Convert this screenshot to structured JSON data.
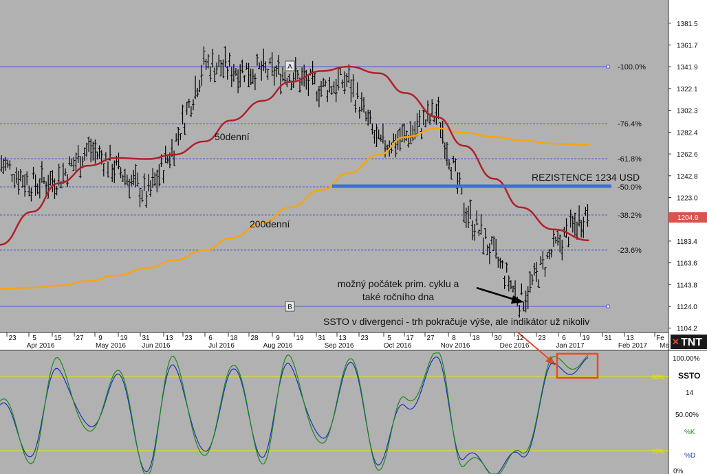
{
  "colors": {
    "background": "#b1b1b1",
    "price_bars": "#000000",
    "ma50": "#b0202a",
    "ma200": "#f6a50e",
    "fib_lines": "#2b3fd8",
    "resistance": "#3f6fd6",
    "stoch_k": "#1a8a1a",
    "stoch_d": "#1f2fb8",
    "stoch_levels": "#e8e800",
    "price_label_bg": "#d9534f",
    "callout_box": "#e8492c"
  },
  "price_axis": {
    "ticks": [
      "1381.5",
      "1361.7",
      "1341.9",
      "1322.1",
      "1302.3",
      "1282.4",
      "1262.6",
      "1242.8",
      "1223.0",
      "1204.9",
      "1183.4",
      "1163.6",
      "1143.8",
      "1124.0",
      "1104.2"
    ],
    "current_price": "1204.9"
  },
  "date_axis": {
    "day_labels": [
      "23",
      "5",
      "15",
      "27",
      "9",
      "19",
      "31",
      "13",
      "23",
      "6",
      "18",
      "28",
      "9",
      "19",
      "31",
      "13",
      "23",
      "5",
      "17",
      "27",
      "8",
      "18",
      "30",
      "12",
      "23",
      "6",
      "19",
      "31",
      "13",
      "Fe"
    ],
    "month_labels": [
      "Apr 2016",
      "May 2016",
      "Jun 2016",
      "Jul 2016",
      "Aug 2016",
      "Sep 2016",
      "Oct 2016",
      "Nov 2016",
      "Dec 2016",
      "Jan 2017",
      "Feb 2017",
      "Ma"
    ]
  },
  "fib_labels": [
    "-100.0%",
    "-76.4%",
    "-61.8%",
    "-50.0%",
    "-38.2%",
    "-23.6%"
  ],
  "point_labels": {
    "a": "A",
    "b": "B"
  },
  "annotations": {
    "ma50": "50denní",
    "ma200": "200denní",
    "resistance": "REZISTENCE 1234 USD",
    "cycle_low_1": "možný počátek prim. cyklu a",
    "cycle_low_2": "také ročního dna",
    "divergence": "SSTO v divergenci - trh pokračuje výše, ale indikátor už nikoliv"
  },
  "oscillator": {
    "name": "SSTO",
    "period": "14",
    "levels": [
      "100.00%",
      "80%",
      "50.00%",
      "20%",
      "0%"
    ],
    "level_80": "80%",
    "level_20": "20%",
    "k_label": "%K",
    "d_label": "%D"
  },
  "logo_text": "TNT",
  "chart_data": [
    {
      "type": "line",
      "title": "",
      "x": [
        "2016-03-15",
        "2016-04-01",
        "2016-04-15",
        "2016-05-01",
        "2016-05-15",
        "2016-06-01",
        "2016-06-15",
        "2016-07-01",
        "2016-07-15",
        "2016-08-01",
        "2016-08-15",
        "2016-09-01",
        "2016-09-15",
        "2016-10-01",
        "2016-10-15",
        "2016-11-01",
        "2016-11-15",
        "2016-12-01",
        "2016-12-15",
        "2017-01-01",
        "2017-01-20"
      ],
      "series": [
        {
          "name": "50denní",
          "values": [
            1180,
            1210,
            1236,
            1252,
            1259,
            1258,
            1262,
            1274,
            1293,
            1311,
            1328,
            1338,
            1342,
            1336,
            1318,
            1296,
            1270,
            1240,
            1214,
            1194,
            1184
          ]
        },
        {
          "name": "200denní",
          "values": [
            1140,
            1141,
            1143,
            1147,
            1152,
            1159,
            1166,
            1175,
            1186,
            1200,
            1214,
            1230,
            1245,
            1262,
            1278,
            1286,
            1282,
            1278,
            1275,
            1272,
            1271
          ]
        },
        {
          "name": "price",
          "values": [
            1255,
            1235,
            1240,
            1268,
            1250,
            1225,
            1270,
            1345,
            1340,
            1338,
            1335,
            1322,
            1330,
            1270,
            1278,
            1300,
            1215,
            1170,
            1128,
            1175,
            1212
          ]
        }
      ],
      "ylim": [
        1104.2,
        1391
      ]
    },
    {
      "type": "line",
      "title": "",
      "x": [
        "2016-03-15",
        "2016-04-01",
        "2016-04-15",
        "2016-05-01",
        "2016-05-15",
        "2016-06-01",
        "2016-06-15",
        "2016-07-01",
        "2016-07-15",
        "2016-08-01",
        "2016-08-15",
        "2016-09-01",
        "2016-09-15",
        "2016-10-01",
        "2016-10-15",
        "2016-11-01",
        "2016-11-15",
        "2016-12-01",
        "2016-12-15",
        "2017-01-01",
        "2017-01-20"
      ],
      "series": [
        {
          "name": "%K",
          "values": [
            60,
            15,
            95,
            30,
            85,
            5,
            95,
            10,
            90,
            15,
            95,
            20,
            95,
            10,
            60,
            95,
            10,
            5,
            15,
            90,
            93
          ]
        },
        {
          "name": "%D",
          "values": [
            55,
            20,
            88,
            35,
            80,
            8,
            90,
            14,
            85,
            20,
            90,
            25,
            90,
            14,
            55,
            90,
            14,
            6,
            14,
            85,
            90
          ]
        }
      ],
      "ylim": [
        0,
        100
      ]
    }
  ]
}
